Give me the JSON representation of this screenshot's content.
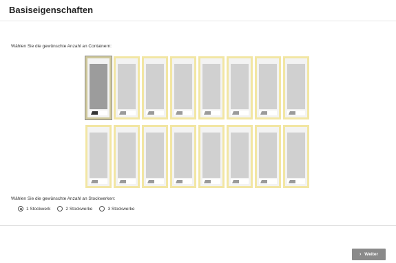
{
  "header": {
    "title": "Basiseigenschaften"
  },
  "containers": {
    "label": "Wählen Sie die gewünschte Anzahl an Containern:",
    "rows": 2,
    "columns": 8,
    "selected_index": 0
  },
  "floors": {
    "label": "Wählen Sie die gewünschte Anzahl an Stockwerken:",
    "options": [
      {
        "label": "1 Stockwerk",
        "checked": true
      },
      {
        "label": "2 Stockwerke",
        "checked": false
      },
      {
        "label": "3 Stockwerke",
        "checked": false
      }
    ]
  },
  "footer": {
    "next_label": "Weiter",
    "next_icon": "chevron-right-icon"
  },
  "colors": {
    "container_frame": "#f2e6a3",
    "selected_panel": "#9c9c9c",
    "button": "#8a8a8a"
  }
}
